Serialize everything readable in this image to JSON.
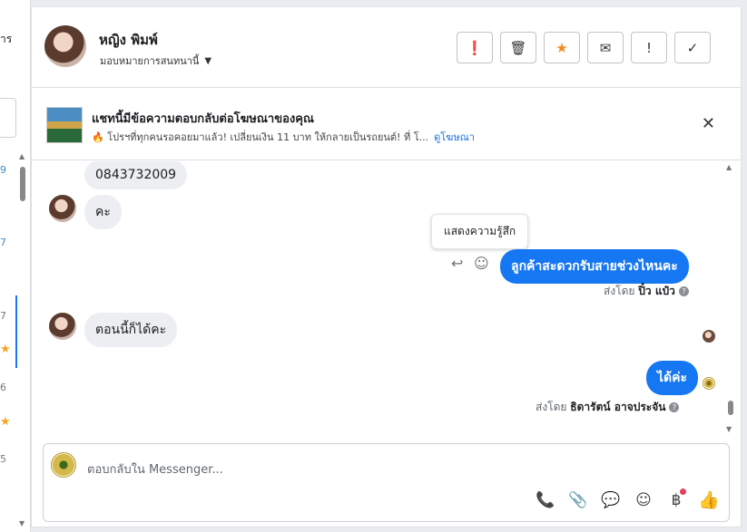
{
  "left_list": {
    "cut_text": "าร",
    "nums": [
      "9",
      "7",
      "7",
      "6",
      "5"
    ]
  },
  "header": {
    "contact_name": "หญิง พิมพ์",
    "assign_label": "มอบหมายการสนทนานี้",
    "actions": [
      {
        "name": "mark-spam",
        "icon": "exclamation-circle-icon",
        "glyph": "❗"
      },
      {
        "name": "delete",
        "icon": "trash-icon",
        "glyph": "🗑"
      },
      {
        "name": "star",
        "icon": "star-icon",
        "glyph": "★"
      },
      {
        "name": "mark-unread",
        "icon": "envelope-icon",
        "glyph": "✉"
      },
      {
        "name": "follow-up",
        "icon": "exclamation-icon",
        "glyph": "!"
      },
      {
        "name": "done",
        "icon": "checkmark-icon",
        "glyph": "✓"
      }
    ]
  },
  "ad_banner": {
    "title": "แชทนี้มีข้อความตอบกลับต่อโฆษณาของคุณ",
    "subtitle": "🔥 โปรฯที่ทุกคนรอคอยมาแล้ว! เปลี่ยนเงิน 11 บาท ให้กลายเป็นรถยนต์! ที่ โ...",
    "link": "ดูโฆษณา",
    "close_glyph": "✕"
  },
  "messages": {
    "in_1": "0843732009",
    "in_2": "คะ",
    "out_1": "ลูกค้าสะดวกรับสายช่วงไหนคะ",
    "tooltip": "แสดงความรู้สึก",
    "sent_by_1_prefix": "ส่งโดย",
    "sent_by_1_name": "ปิ๋ว แป๋ว",
    "in_3": "ตอนนี้ก็ได้คะ",
    "out_2": "ได้ค่ะ",
    "sent_by_2_prefix": "ส่งโดย",
    "sent_by_2_name": "ธิดารัตน์ อาจประจัน"
  },
  "composer": {
    "placeholder": "ตอบกลับใน Messenger...",
    "tools": [
      {
        "name": "call-button",
        "icon": "phone-plus-icon",
        "glyph": "📞"
      },
      {
        "name": "attach-button",
        "icon": "paperclip-icon",
        "glyph": "📎"
      },
      {
        "name": "saved-replies-button",
        "icon": "chat-bubble-icon",
        "glyph": "💬"
      },
      {
        "name": "emoji-button",
        "icon": "smiley-icon",
        "glyph": "☺"
      },
      {
        "name": "payment-button",
        "icon": "baht-icon",
        "glyph": "฿"
      },
      {
        "name": "like-button",
        "icon": "thumbs-up-icon",
        "glyph": "👍"
      }
    ]
  }
}
